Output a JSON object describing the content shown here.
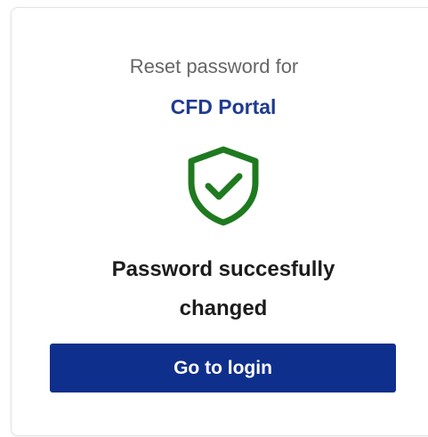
{
  "reset": {
    "subtitle": "Reset password for",
    "app_name": "CFD Portal",
    "message_line1": "Password succesfully",
    "message_line2": "changed",
    "login_button": "Go to login"
  },
  "icon": {
    "name": "shield-check-icon",
    "color": "#1f7a1f"
  },
  "colors": {
    "accent": "#1f3b8f",
    "button": "#0f2f8c",
    "success": "#1f7a1f"
  }
}
